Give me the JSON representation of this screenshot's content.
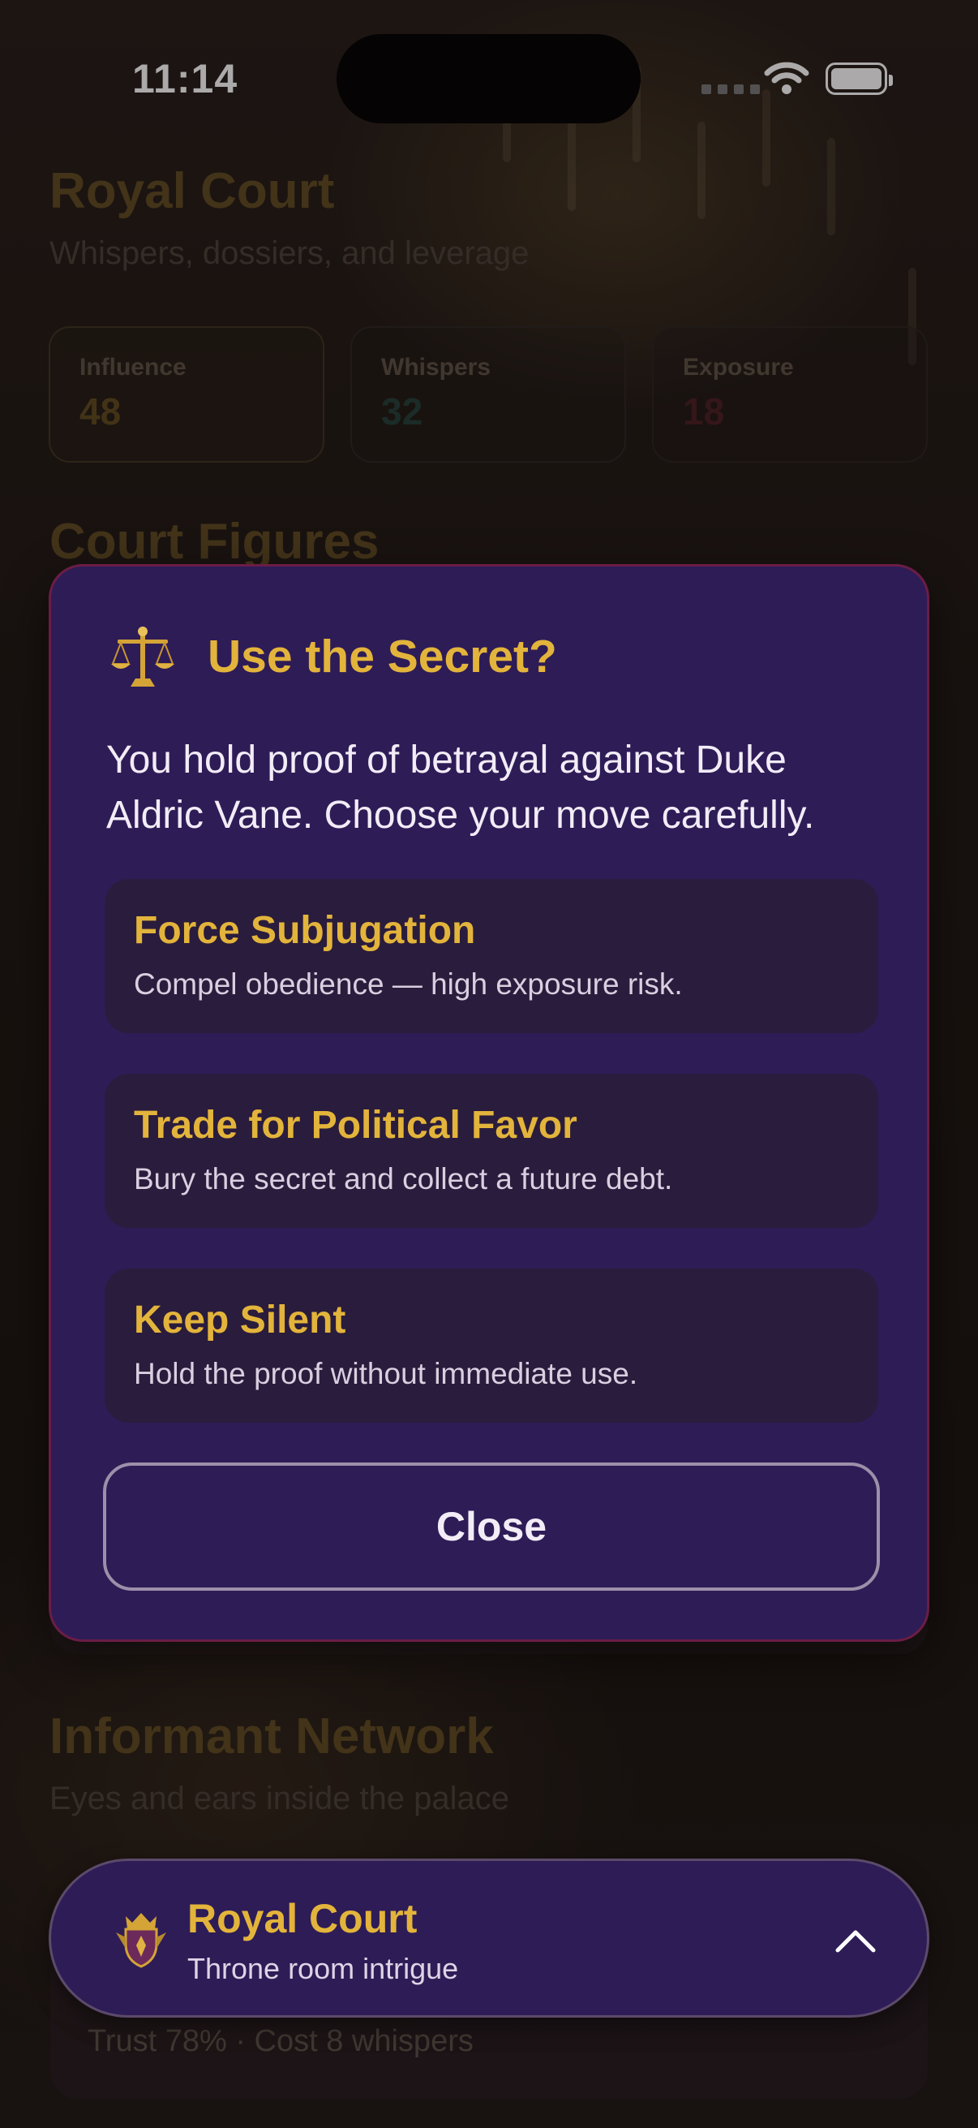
{
  "status": {
    "time": "11:14"
  },
  "header": {
    "title": "Royal Court",
    "subtitle": "Whispers, dossiers, and leverage"
  },
  "stats": [
    {
      "label": "Influence",
      "value": "48"
    },
    {
      "label": "Whispers",
      "value": "32"
    },
    {
      "label": "Exposure",
      "value": "18"
    }
  ],
  "sections": {
    "court_figures": "Court Figures",
    "informant_title": "Informant Network",
    "informant_subtitle": "Eyes and ears inside the palace",
    "informant_meta": "Trust 78% · Cost 8 whispers"
  },
  "modal": {
    "icon": "scales-icon",
    "title": "Use the Secret?",
    "body": "You hold proof of betrayal against Duke Aldric Vane. Choose your move carefully.",
    "options": [
      {
        "title": "Force Subjugation",
        "desc": "Compel obedience — high exposure risk."
      },
      {
        "title": "Trade for Political Favor",
        "desc": "Bury the secret and collect a future debt."
      },
      {
        "title": "Keep Silent",
        "desc": "Hold the proof without immediate use."
      }
    ],
    "close_label": "Close"
  },
  "bottom_bar": {
    "icon": "crest-icon",
    "title": "Royal Court",
    "subtitle": "Throne room intrigue",
    "chevron": "chevron-up-icon"
  },
  "colors": {
    "accent": "#e3b43b",
    "modal_bg": "#2e1c57",
    "option_bg": "#2a1c3c",
    "modal_border": "#6b1d45"
  }
}
